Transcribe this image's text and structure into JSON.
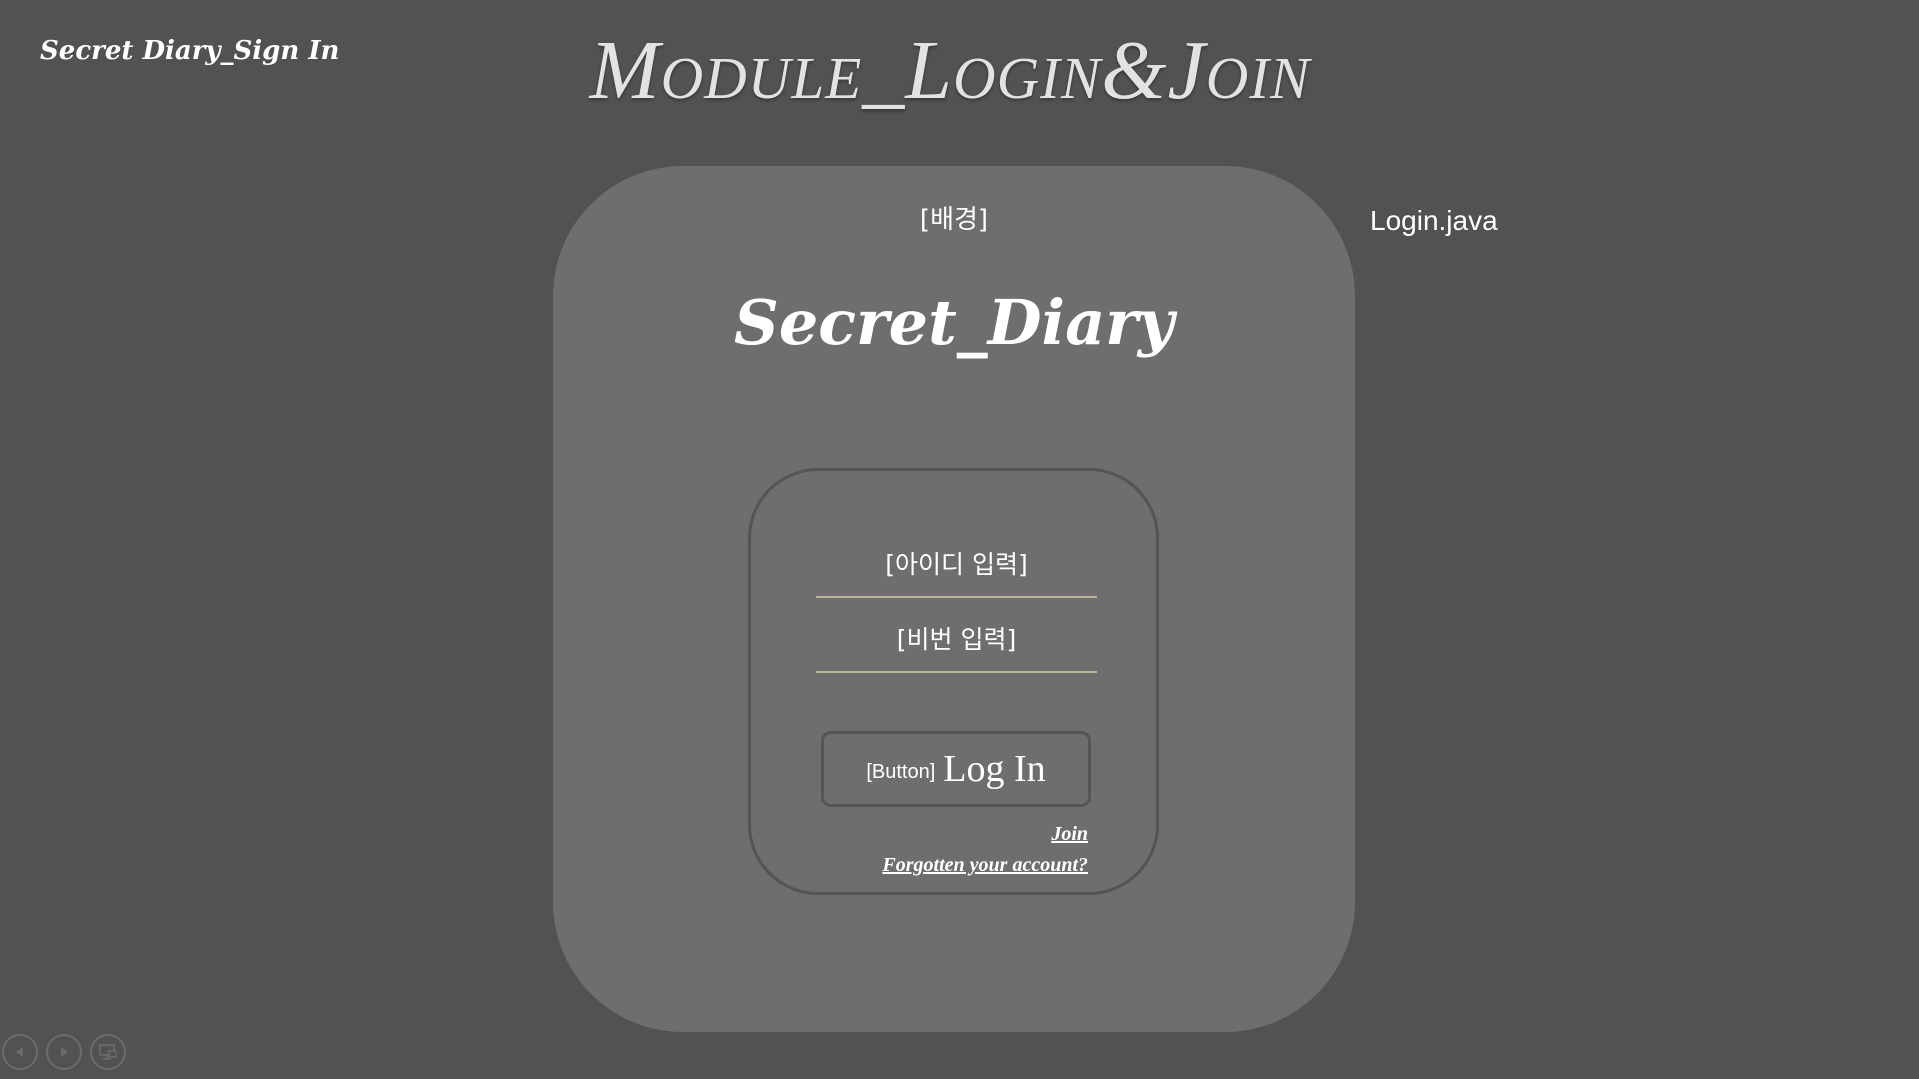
{
  "slide": {
    "corner_title": "Secret Diary_Sign In",
    "heading": "Module_Login&Join",
    "file_label": "Login.java"
  },
  "screen": {
    "background_label": "[배경]",
    "app_title": "Secret_Diary",
    "id_field_label": "[아이디 입력]",
    "password_field_label": "[비번 입력]",
    "login_button_tag": "[Button]",
    "login_button_label": "Log In",
    "join_link": "Join",
    "forgot_link": "Forgotten your account?"
  },
  "controls": {
    "icons": [
      "previous-icon",
      "next-icon",
      "slide-show-icon"
    ]
  },
  "colors": {
    "slide_background": "#525252",
    "panel_background": "#6e6e6e",
    "field_underline": "#b9b49a",
    "text": "#ffffff"
  }
}
